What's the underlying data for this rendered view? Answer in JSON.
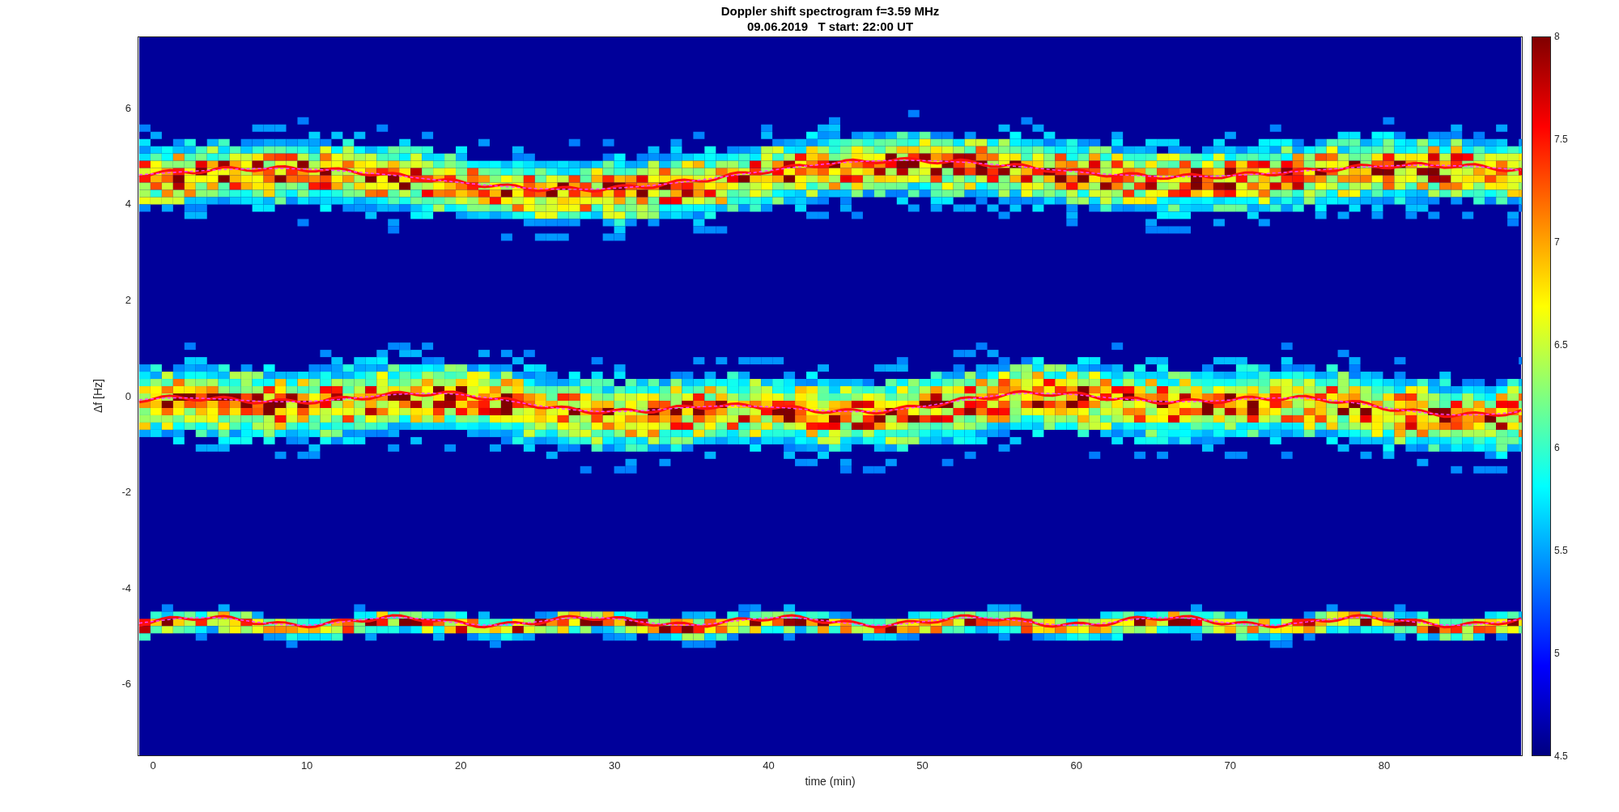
{
  "title": "Doppler shift spectrogram f=3.59 MHz",
  "subtitle": "09.06.2019   T start: 22:00 UT",
  "ylabel": "Δf [Hz]",
  "xlabel": "time (min)",
  "yticks": [
    "6",
    "4",
    "2",
    "0",
    "-2",
    "-4",
    "-6"
  ],
  "xticks": [
    "0",
    "10",
    "20",
    "30",
    "40",
    "50",
    "60",
    "70",
    "80"
  ],
  "colorbar_ticks": [
    "8",
    "7.5",
    "7",
    "6.5",
    "6",
    "5.5",
    "5",
    "4.5"
  ]
}
